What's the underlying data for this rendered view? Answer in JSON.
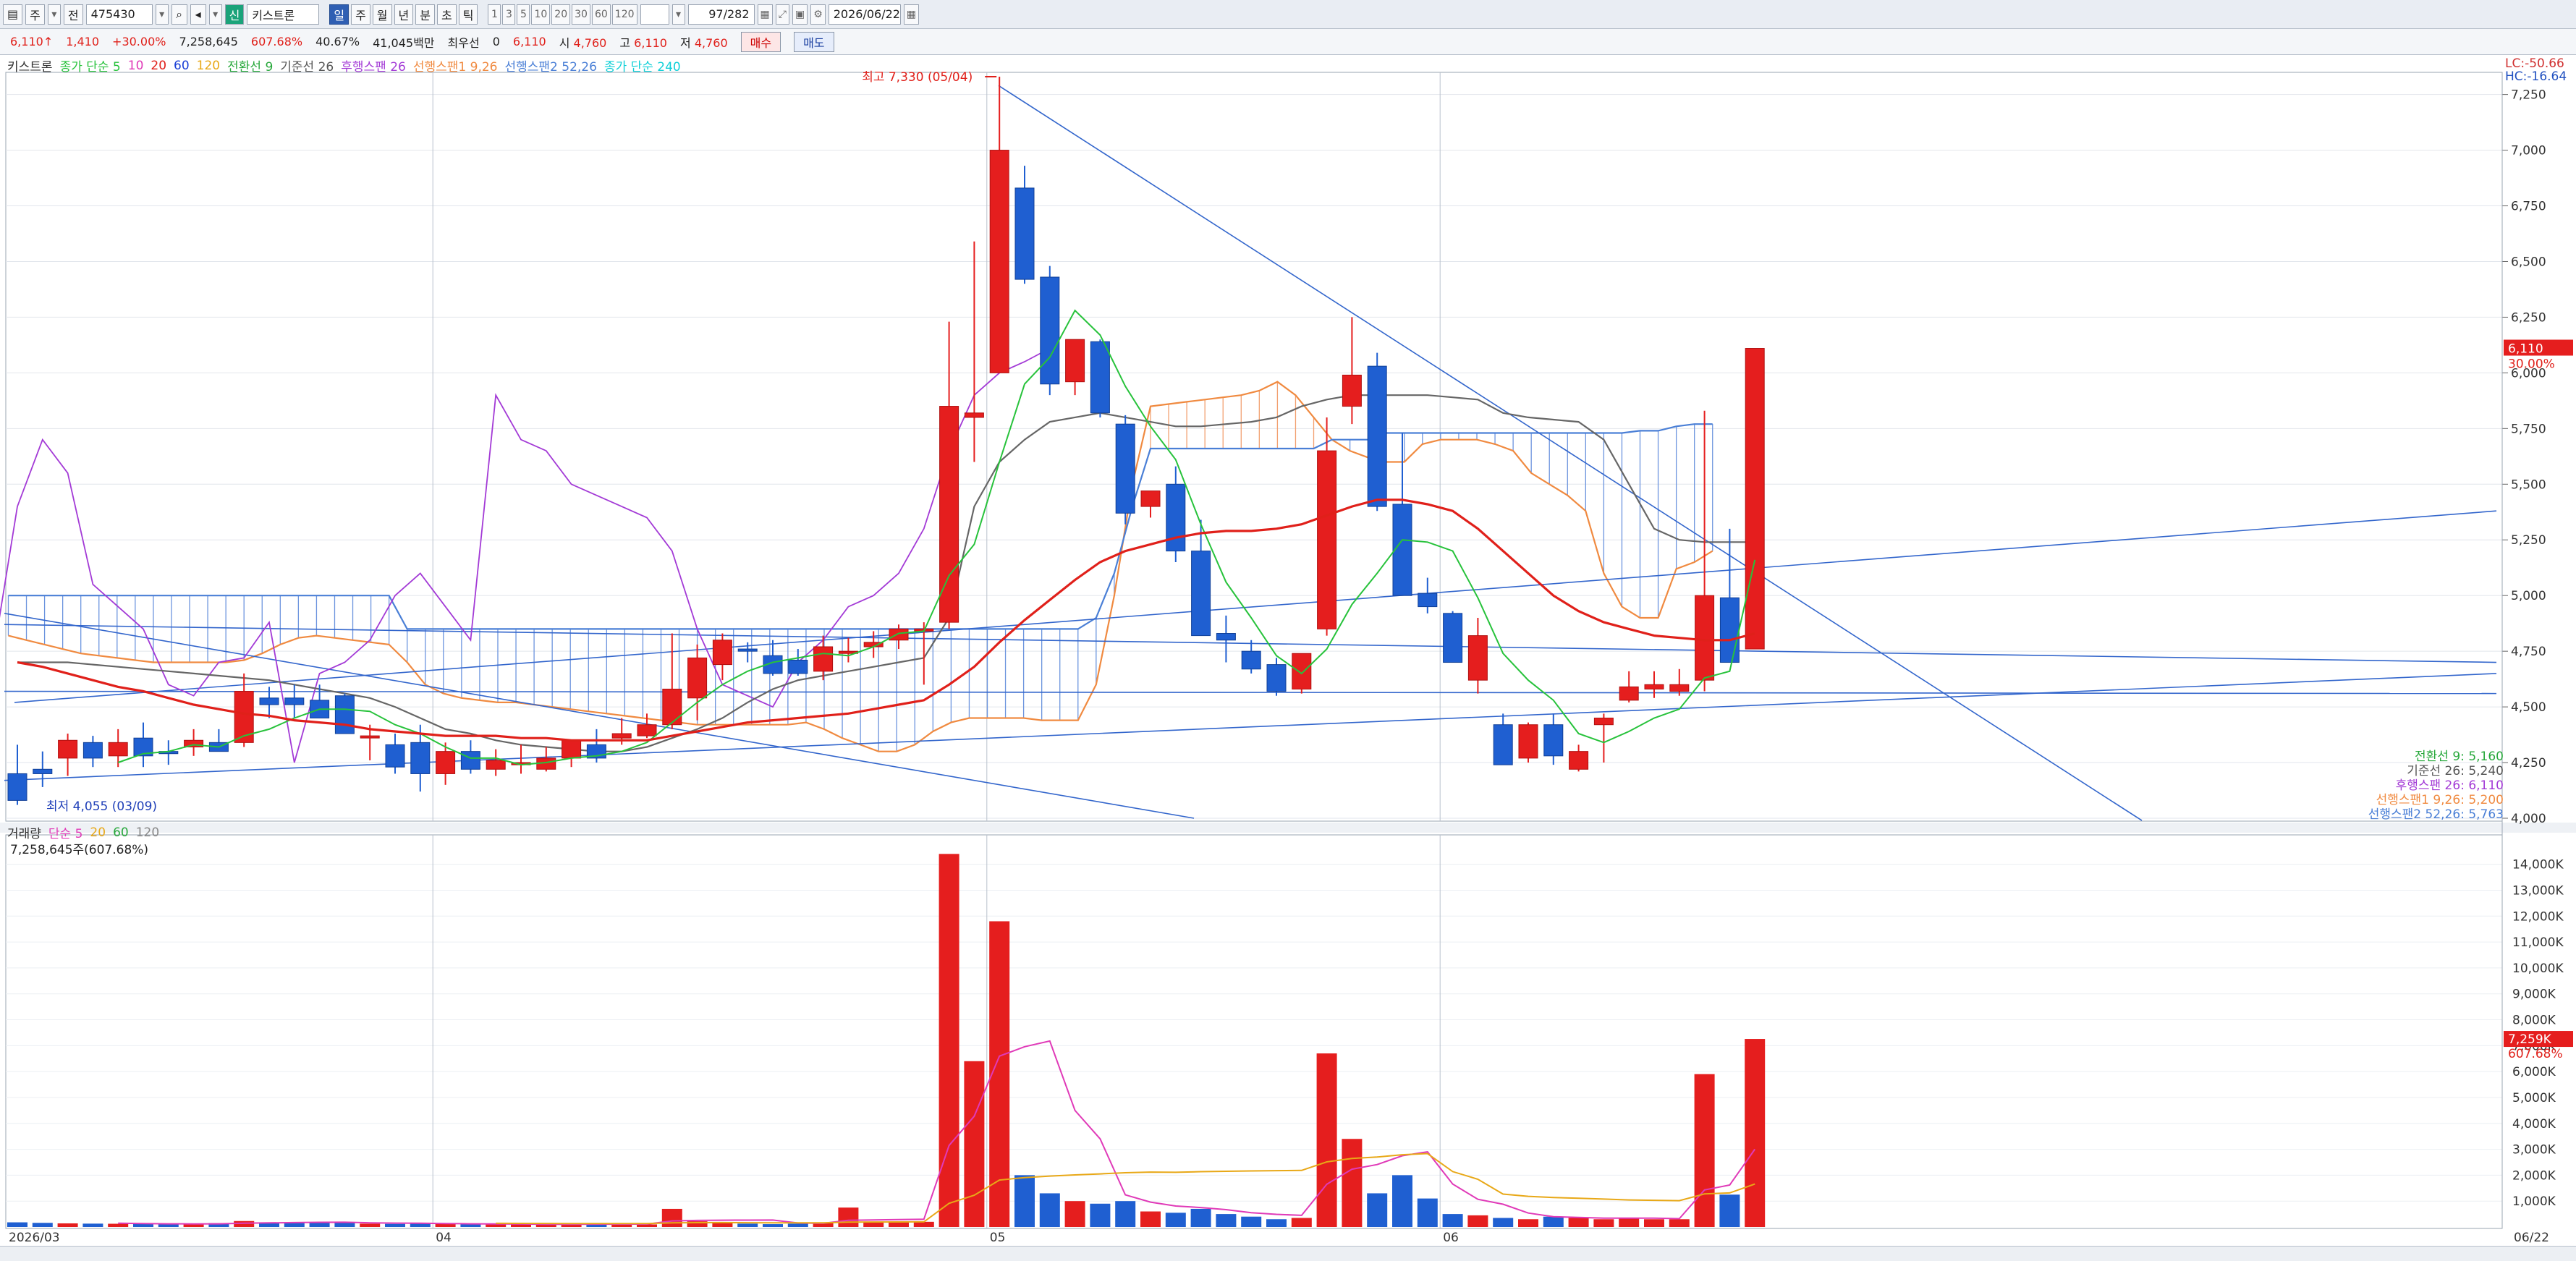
{
  "toolbar": {
    "mode_select": "주",
    "market": "전",
    "code": "475430",
    "stock_badge": "신",
    "stock_name": "키스트론",
    "periods": [
      "일",
      "주",
      "월",
      "년",
      "분",
      "초",
      "틱"
    ],
    "active_period": "일",
    "intervals": [
      "1",
      "3",
      "5",
      "10",
      "20",
      "30",
      "60",
      "120"
    ],
    "page_counter": "97/282",
    "date": "2026/06/22"
  },
  "quote": {
    "price": "6,110",
    "arrow": "↑",
    "change": "1,410",
    "change_pct": "+30.00%",
    "volume": "7,258,645",
    "volume_ratio": "607.68%",
    "turnover_pct": "40.67%",
    "amount": "41,045백만",
    "pref_label": "최우선",
    "pref_value": "0",
    "pref_price": "6,110",
    "open_label": "시",
    "open": "4,760",
    "high_label": "고",
    "high": "6,110",
    "low_label": "저",
    "low": "4,760",
    "buy_label": "매수",
    "sell_label": "매도"
  },
  "price_legend": [
    {
      "text": "키스트론",
      "color": "#333333"
    },
    {
      "text": "종가 단순 5",
      "color": "#27c23b"
    },
    {
      "text": "10",
      "color": "#e03ab8"
    },
    {
      "text": "20",
      "color": "#e0201a"
    },
    {
      "text": "60",
      "color": "#1a3fd6"
    },
    {
      "text": "120",
      "color": "#e8a817"
    },
    {
      "text": "전환선 9",
      "color": "#27a83b"
    },
    {
      "text": "기준선 26",
      "color": "#555555"
    },
    {
      "text": "후행스팬 26",
      "color": "#a33ad6"
    },
    {
      "text": "선행스팬1 9,26",
      "color": "#f08a40"
    },
    {
      "text": "선행스팬2 52,26",
      "color": "#4a7fd6"
    },
    {
      "text": "종가 단순 240",
      "color": "#10d0d8"
    }
  ],
  "volume_legend": [
    {
      "text": "거래량",
      "color": "#333333"
    },
    {
      "text": "단순 5",
      "color": "#e03ab8"
    },
    {
      "text": "20",
      "color": "#e8a817"
    },
    {
      "text": "60",
      "color": "#27a83b"
    },
    {
      "text": "120",
      "color": "#888888"
    }
  ],
  "volume_sub": "7,258,645주(607.68%)",
  "top_right": {
    "lc": "LC:-50.66",
    "hc": "HC:-16.64"
  },
  "current_price_box": "6,110",
  "current_price_pct": "30.00%",
  "current_vol_box": "7,259K",
  "current_vol_pct": "607.68%",
  "ichimoku_labels": [
    {
      "text": "전환선 9: 5,160",
      "color": "#27a83b"
    },
    {
      "text": "기준선 26: 5,240",
      "color": "#555555"
    },
    {
      "text": "후행스팬 26: 6,110",
      "color": "#a33ad6"
    },
    {
      "text": "선행스팬1 9,26: 5,200",
      "color": "#f08a40"
    },
    {
      "text": "선행스팬2 52,26: 5,763",
      "color": "#4a7fd6"
    }
  ],
  "bottom_right_date": "06/22",
  "chart_data": {
    "type": "candlestick",
    "ylim": [
      4000,
      7330
    ],
    "yticks": [
      4000,
      4250,
      4500,
      4750,
      5000,
      5250,
      5500,
      5750,
      6000,
      6250,
      6500,
      6750,
      7000,
      7250
    ],
    "volume_ylim": [
      0,
      14800
    ],
    "volume_ticks": [
      "1,000K",
      "2,000K",
      "3,000K",
      "4,000K",
      "5,000K",
      "6,000K",
      "7,000K",
      "8,000K",
      "9,000K",
      "10,000K",
      "11,000K",
      "12,000K",
      "13,000K",
      "14,000K"
    ],
    "volume_tick_values": [
      1000,
      2000,
      3000,
      4000,
      5000,
      6000,
      7000,
      8000,
      9000,
      10000,
      11000,
      12000,
      13000,
      14000
    ],
    "month_labels": [
      {
        "text": "2026/03",
        "index": 0
      },
      {
        "text": "04",
        "index": 17
      },
      {
        "text": "05",
        "index": 39
      },
      {
        "text": "06",
        "index": 57
      }
    ],
    "annotations": {
      "high": {
        "text": "최고 7,330 (05/04)",
        "index": 39,
        "value": 7330
      },
      "low": {
        "text": "최저 4,055 (03/09)",
        "index": 0,
        "value": 4055
      }
    },
    "candles": [
      [
        4200,
        4330,
        4060,
        4080
      ],
      [
        4220,
        4300,
        4140,
        4200
      ],
      [
        4270,
        4380,
        4190,
        4350
      ],
      [
        4340,
        4370,
        4230,
        4270
      ],
      [
        4280,
        4400,
        4230,
        4340
      ],
      [
        4360,
        4430,
        4230,
        4280
      ],
      [
        4300,
        4350,
        4240,
        4290
      ],
      [
        4320,
        4400,
        4280,
        4350
      ],
      [
        4340,
        4400,
        4320,
        4300
      ],
      [
        4340,
        4650,
        4320,
        4570
      ],
      [
        4540,
        4590,
        4450,
        4510
      ],
      [
        4540,
        4600,
        4450,
        4510
      ],
      [
        4530,
        4600,
        4450,
        4450
      ],
      [
        4550,
        4560,
        4400,
        4380
      ],
      [
        4370,
        4420,
        4260,
        4370
      ],
      [
        4330,
        4380,
        4200,
        4230
      ],
      [
        4340,
        4420,
        4120,
        4200
      ],
      [
        4200,
        4340,
        4150,
        4300
      ],
      [
        4300,
        4350,
        4200,
        4220
      ],
      [
        4220,
        4310,
        4190,
        4260
      ],
      [
        4240,
        4330,
        4200,
        4250
      ],
      [
        4220,
        4320,
        4210,
        4270
      ],
      [
        4270,
        4340,
        4230,
        4350
      ],
      [
        4330,
        4400,
        4250,
        4270
      ],
      [
        4360,
        4450,
        4330,
        4380
      ],
      [
        4370,
        4470,
        4360,
        4420
      ],
      [
        4420,
        4830,
        4400,
        4580
      ],
      [
        4540,
        4780,
        4440,
        4720
      ],
      [
        4690,
        4830,
        4620,
        4800
      ],
      [
        4760,
        4790,
        4700,
        4750
      ],
      [
        4730,
        4800,
        4640,
        4650
      ],
      [
        4710,
        4760,
        4640,
        4650
      ],
      [
        4660,
        4820,
        4620,
        4770
      ],
      [
        4740,
        4810,
        4700,
        4750
      ],
      [
        4770,
        4840,
        4720,
        4790
      ],
      [
        4800,
        4870,
        4760,
        4850
      ],
      [
        4850,
        4880,
        4600,
        4850
      ],
      [
        4880,
        6230,
        4850,
        5850
      ],
      [
        5800,
        6590,
        5600,
        5820
      ],
      [
        6000,
        7330,
        6000,
        7000
      ],
      [
        6830,
        6930,
        6400,
        6420
      ],
      [
        6430,
        6480,
        5900,
        5950
      ],
      [
        5960,
        6150,
        5900,
        6150
      ],
      [
        6140,
        6150,
        5800,
        5820
      ],
      [
        5770,
        5810,
        5320,
        5370
      ],
      [
        5400,
        5450,
        5350,
        5470
      ],
      [
        5500,
        5580,
        5150,
        5200
      ],
      [
        5200,
        5340,
        4820,
        4820
      ],
      [
        4830,
        4910,
        4700,
        4800
      ],
      [
        4750,
        4800,
        4650,
        4670
      ],
      [
        4690,
        4720,
        4550,
        4570
      ],
      [
        4580,
        4730,
        4560,
        4740
      ],
      [
        4850,
        5800,
        4820,
        5650
      ],
      [
        5850,
        6250,
        5770,
        5990
      ],
      [
        6030,
        6090,
        5380,
        5400
      ],
      [
        5410,
        5730,
        5000,
        5000
      ],
      [
        5010,
        5080,
        4920,
        4950
      ],
      [
        4920,
        4930,
        4700,
        4700
      ],
      [
        4620,
        4900,
        4560,
        4820
      ],
      [
        4420,
        4470,
        4240,
        4240
      ],
      [
        4270,
        4430,
        4250,
        4420
      ],
      [
        4420,
        4470,
        4240,
        4280
      ],
      [
        4220,
        4330,
        4210,
        4300
      ],
      [
        4420,
        4470,
        4250,
        4450
      ],
      [
        4530,
        4660,
        4520,
        4590
      ],
      [
        4580,
        4660,
        4540,
        4600
      ],
      [
        4570,
        4670,
        4550,
        4600
      ],
      [
        4620,
        5830,
        4570,
        5000
      ],
      [
        4990,
        5300,
        4700,
        4700
      ],
      [
        4760,
        6110,
        4760,
        6110
      ]
    ],
    "volumes": [
      180,
      160,
      140,
      130,
      125,
      115,
      110,
      120,
      150,
      230,
      180,
      175,
      170,
      160,
      130,
      120,
      140,
      120,
      110,
      100,
      100,
      90,
      120,
      140,
      110,
      100,
      700,
      220,
      180,
      130,
      110,
      130,
      160,
      750,
      210,
      180,
      200,
      14400,
      6400,
      11800,
      2000,
      1300,
      1000,
      900,
      1000,
      600,
      550,
      700,
      500,
      400,
      300,
      350,
      6700,
      3400,
      1300,
      2000,
      1100,
      500,
      450,
      350,
      300,
      400,
      350,
      300,
      350,
      300,
      300,
      5900,
      1250,
      7259
    ],
    "ma5": [
      null,
      null,
      null,
      null,
      4250,
      4290,
      4300,
      4330,
      4320,
      4370,
      4400,
      4450,
      4490,
      4490,
      4480,
      4420,
      4380,
      4320,
      4270,
      4270,
      4240,
      4250,
      4270,
      4280,
      4300,
      4340,
      4430,
      4520,
      4600,
      4660,
      4700,
      4720,
      4740,
      4730,
      4770,
      4830,
      4840,
      5090,
      5230,
      5600,
      5950,
      6070,
      6280,
      6170,
      5940,
      5760,
      5610,
      5320,
      5060,
      4900,
      4730,
      4650,
      4760,
      4960,
      5100,
      5250,
      5240,
      5200,
      4990,
      4740,
      4620,
      4530,
      4380,
      4340,
      4390,
      4450,
      4490,
      4630,
      4660,
      5160
    ],
    "ma20": [
      4700,
      4680,
      4650,
      4620,
      4590,
      4570,
      4540,
      4510,
      4490,
      4470,
      4460,
      4440,
      4430,
      4420,
      4400,
      4390,
      4380,
      4370,
      4370,
      4370,
      4360,
      4360,
      4350,
      4350,
      4350,
      4350,
      4370,
      4390,
      4410,
      4430,
      4440,
      4450,
      4460,
      4470,
      4490,
      4510,
      4530,
      4600,
      4680,
      4790,
      4890,
      4980,
      5070,
      5150,
      5200,
      5230,
      5260,
      5280,
      5290,
      5290,
      5300,
      5320,
      5360,
      5400,
      5430,
      5430,
      5410,
      5380,
      5300,
      5200,
      5100,
      5000,
      4930,
      4880,
      4850,
      4820,
      4810,
      4800,
      4800,
      4830
    ],
    "ichimoku_base": [
      4700,
      4700,
      4700,
      4690,
      4680,
      4670,
      4660,
      4650,
      4640,
      4630,
      4620,
      4600,
      4580,
      4560,
      4540,
      4500,
      4450,
      4400,
      4380,
      4350,
      4330,
      4320,
      4310,
      4300,
      4300,
      4320,
      4360,
      4400,
      4450,
      4520,
      4580,
      4620,
      4640,
      4660,
      4680,
      4700,
      4720,
      4900,
      5400,
      5600,
      5700,
      5780,
      5800,
      5820,
      5800,
      5780,
      5760,
      5760,
      5770,
      5780,
      5800,
      5850,
      5880,
      5900,
      5900,
      5900,
      5900,
      5890,
      5880,
      5820,
      5800,
      5790,
      5780,
      5700,
      5500,
      5300,
      5250,
      5240,
      5240,
      5240
    ],
    "ichimoku_lagging": [
      5600,
      5900,
      6300,
      5900,
      5200,
      5100,
      4900,
      4700,
      4650,
      5750,
      5850,
      5900,
      5950,
      5850,
      5800,
      5300,
      5050,
      4950,
      4900,
      4850,
      4700,
      4650,
      4550,
      4700,
      4600,
      4700,
      5400,
      5700,
      5550,
      5050,
      4950,
      4850,
      4600,
      4550,
      4700,
      4720,
      4880,
      4250,
      4650,
      4700,
      4800,
      5000,
      5100,
      4950,
      4800,
      5900,
      5700,
      5650,
      5500,
      5450,
      5400,
      5350,
      5200,
      4850,
      4600,
      4550,
      4500,
      4700,
      4800,
      4950,
      5000,
      5100,
      5300,
      5650,
      5900,
      6000,
      6050,
      6110
    ],
    "cloud_span1": [
      4820,
      4800,
      4780,
      4760,
      4740,
      4730,
      4720,
      4710,
      4700,
      4700,
      4700,
      4700,
      4700,
      4710,
      4740,
      4780,
      4810,
      4820,
      4810,
      4800,
      4790,
      4780,
      4700,
      4600,
      4560,
      4540,
      4530,
      4520,
      4520,
      4510,
      4500,
      4490,
      4480,
      4470,
      4460,
      4450,
      4440,
      4430,
      4420,
      4420,
      4420,
      4420,
      4420,
      4420,
      4430,
      4400,
      4360,
      4330,
      4300,
      4300,
      4330,
      4390,
      4430,
      4450,
      4450,
      4450,
      4450,
      4440,
      4440,
      4440,
      4600,
      5000,
      5500,
      5850,
      5860,
      5870,
      5880,
      5890,
      5900,
      5920,
      5960,
      5900,
      5800,
      5700,
      5650,
      5620,
      5600,
      5600,
      5680,
      5700,
      5700,
      5700,
      5680,
      5650,
      5550,
      5500,
      5450,
      5380,
      5100,
      4950,
      4900,
      4900,
      5120,
      5150,
      5200
    ],
    "cloud_span2": [
      5000,
      5000,
      5000,
      5000,
      5000,
      5000,
      5000,
      5000,
      5000,
      5000,
      5000,
      5000,
      5000,
      5000,
      5000,
      5000,
      5000,
      5000,
      5000,
      5000,
      5000,
      5000,
      4850,
      4850,
      4850,
      4850,
      4850,
      4850,
      4850,
      4850,
      4850,
      4850,
      4850,
      4850,
      4850,
      4850,
      4850,
      4850,
      4850,
      4850,
      4850,
      4850,
      4850,
      4850,
      4850,
      4850,
      4850,
      4850,
      4850,
      4850,
      4850,
      4850,
      4850,
      4850,
      4850,
      4850,
      4850,
      4850,
      4850,
      4850,
      4900,
      5100,
      5400,
      5660,
      5660,
      5660,
      5660,
      5660,
      5660,
      5660,
      5660,
      5660,
      5660,
      5700,
      5700,
      5700,
      5730,
      5730,
      5730,
      5730,
      5730,
      5730,
      5730,
      5730,
      5730,
      5730,
      5730,
      5730,
      5730,
      5730,
      5740,
      5740,
      5760,
      5770,
      5770
    ]
  }
}
